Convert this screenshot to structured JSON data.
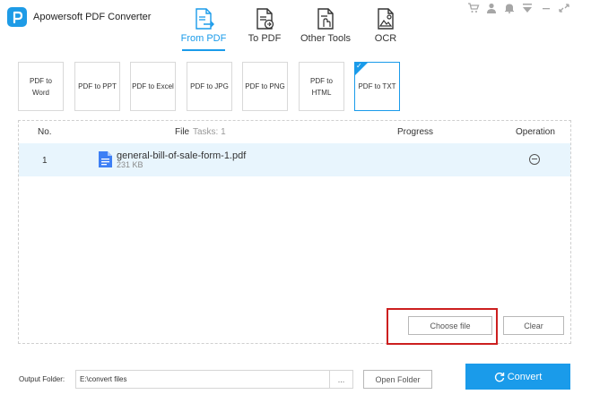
{
  "app": {
    "title": "Apowersoft PDF Converter"
  },
  "nav": {
    "tabs": [
      {
        "label": "From PDF",
        "icon": "pdf-export-icon",
        "active": true
      },
      {
        "label": "To PDF",
        "icon": "pdf-import-icon",
        "active": false
      },
      {
        "label": "Other Tools",
        "icon": "tools-icon",
        "active": false
      },
      {
        "label": "OCR",
        "icon": "ocr-icon",
        "active": false
      }
    ]
  },
  "window_controls": [
    "cart-icon",
    "user-icon",
    "notification-icon",
    "menu-icon",
    "minimize-icon",
    "restore-icon"
  ],
  "modes": [
    {
      "label": "PDF to\nWord",
      "selected": false
    },
    {
      "label": "PDF to PPT",
      "selected": false
    },
    {
      "label": "PDF to Excel",
      "selected": false
    },
    {
      "label": "PDF to JPG",
      "selected": false
    },
    {
      "label": "PDF to PNG",
      "selected": false
    },
    {
      "label": "PDF to\nHTML",
      "selected": false
    },
    {
      "label": "PDF to TXT",
      "selected": true
    }
  ],
  "table": {
    "col_no": "No.",
    "col_file": "File",
    "col_tasks": "Tasks: 1",
    "col_progress": "Progress",
    "col_operation": "Operation",
    "rows": [
      {
        "no": "1",
        "file_name": "general-bill-of-sale-form-1.pdf",
        "file_size": "231 KB"
      }
    ]
  },
  "buttons": {
    "choose_file": "Choose file",
    "clear": "Clear",
    "open_folder": "Open Folder",
    "convert": "Convert",
    "browse": "..."
  },
  "output": {
    "label": "Output Folder:",
    "path": "E:\\convert files"
  },
  "colors": {
    "accent": "#1a9bea",
    "row_highlight": "#e8f5fd",
    "annotation_box": "#cc1f1f"
  }
}
